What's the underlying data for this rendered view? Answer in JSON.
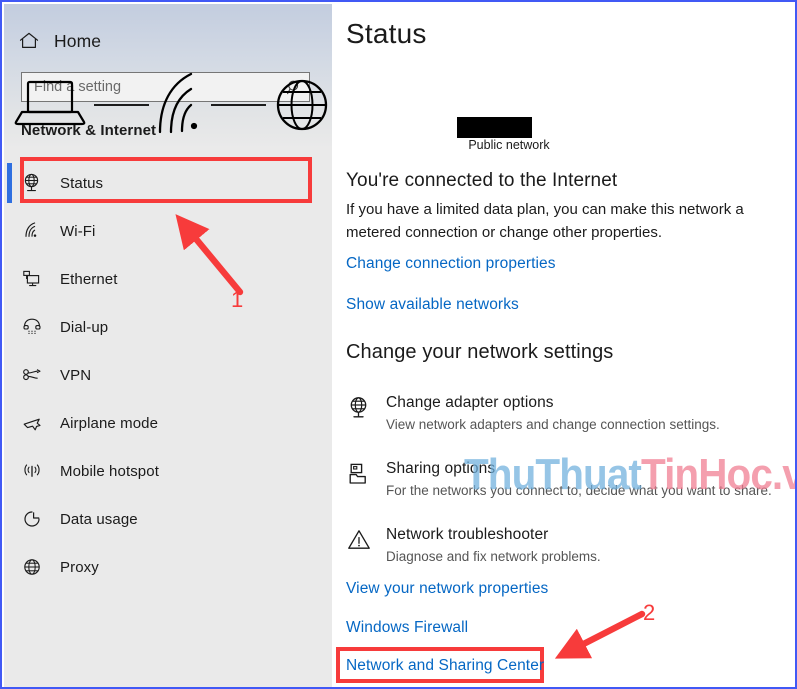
{
  "window": {
    "border_color": "#4159f5"
  },
  "sidebar": {
    "home": {
      "label": "Home",
      "icon": "home-icon"
    },
    "search": {
      "placeholder": "Find a setting",
      "value": "",
      "icon": "search-icon"
    },
    "category_title": "Network & Internet",
    "accent_color": "#2f6fe0",
    "items": [
      {
        "label": "Status",
        "icon": "globe-monitor-icon",
        "selected": true
      },
      {
        "label": "Wi-Fi",
        "icon": "wifi-icon",
        "selected": false
      },
      {
        "label": "Ethernet",
        "icon": "ethernet-icon",
        "selected": false
      },
      {
        "label": "Dial-up",
        "icon": "dialup-phone-icon",
        "selected": false
      },
      {
        "label": "VPN",
        "icon": "vpn-key-icon",
        "selected": false
      },
      {
        "label": "Airplane mode",
        "icon": "airplane-icon",
        "selected": false
      },
      {
        "label": "Mobile hotspot",
        "icon": "hotspot-icon",
        "selected": false
      },
      {
        "label": "Data usage",
        "icon": "data-usage-pie-icon",
        "selected": false
      },
      {
        "label": "Proxy",
        "icon": "proxy-globe-icon",
        "selected": false
      }
    ]
  },
  "main": {
    "title": "Status",
    "diagram": {
      "device_icon": "laptop-icon",
      "network_icon": "wifi-signal-icon",
      "internet_icon": "globe-icon",
      "network_name_redacted": true,
      "network_type_label": "Public network"
    },
    "connection": {
      "heading": "You're connected to the Internet",
      "description": "If you have a limited data plan, you can make this network a metered connection or change other properties."
    },
    "top_links": [
      {
        "label": "Change connection properties"
      },
      {
        "label": "Show available networks"
      }
    ],
    "section_heading": "Change your network settings",
    "settings": [
      {
        "title": "Change adapter options",
        "subtitle": "View network adapters and change connection settings.",
        "icon": "globe-monitor-icon"
      },
      {
        "title": "Sharing options",
        "subtitle": "For the networks you connect to, decide what you want to share.",
        "icon": "shared-folder-icon"
      },
      {
        "title": "Network troubleshooter",
        "subtitle": "Diagnose and fix network problems.",
        "icon": "warning-triangle-icon"
      }
    ],
    "bottom_links": [
      {
        "label": "View your network properties"
      },
      {
        "label": "Windows Firewall"
      },
      {
        "label": "Network and Sharing Center",
        "highlighted": true
      }
    ],
    "link_color": "#0567c4"
  },
  "annotations": {
    "color": "#f73b3b",
    "markers": [
      {
        "number": "1",
        "target": "sidebar-item-status"
      },
      {
        "number": "2",
        "target": "link-network-and-sharing-center"
      }
    ]
  },
  "watermark": {
    "part1": "ThuThuat",
    "part2": "TinHoc.vn",
    "part1_color": "#6eb0dd",
    "part2_color": "#f07b90"
  }
}
